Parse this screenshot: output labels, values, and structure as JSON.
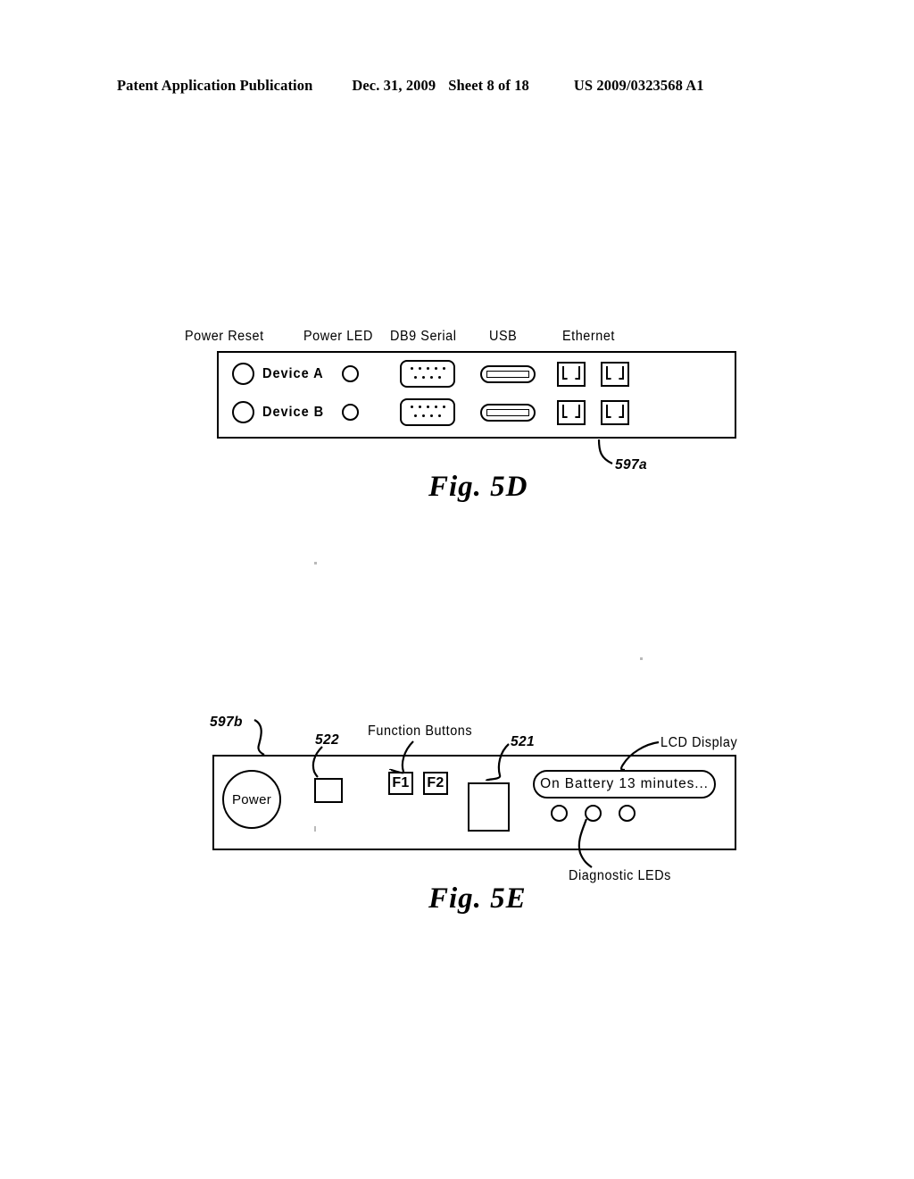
{
  "header": {
    "publication": "Patent Application Publication",
    "date": "Dec. 31, 2009",
    "sheet": "Sheet 8 of 18",
    "patent_number": "US 2009/0323568 A1"
  },
  "figures": [
    {
      "id": "fig-5d",
      "caption": "Fig.  5D",
      "reference_numeral": "597a",
      "column_labels": {
        "power_reset": "Power  Reset",
        "power_led": "Power  LED",
        "db9_serial": "DB9  Serial",
        "usb": "USB",
        "ethernet": "Ethernet"
      },
      "rows": [
        {
          "device_label": "Device  A"
        },
        {
          "device_label": "Device  B"
        }
      ]
    },
    {
      "id": "fig-5e",
      "caption": "Fig.  5E",
      "reference_numeral": "597b",
      "labels": {
        "function_buttons": "Function  Buttons",
        "lcd_display": "LCD  Display",
        "diagnostic_leds": "Diagnostic  LEDs",
        "ref_522": "522",
        "ref_521": "521"
      },
      "controls": {
        "power_button": "Power",
        "function_key_1": "F1",
        "function_key_2": "F2",
        "lcd_text": "On  Battery  13  minutes..."
      }
    }
  ]
}
